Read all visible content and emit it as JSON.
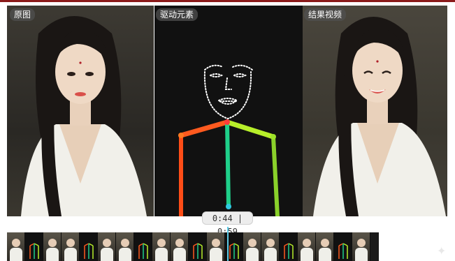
{
  "labels": {
    "original": "原图",
    "driver": "驱动元素",
    "result": "结果视频"
  },
  "player": {
    "time": "0:44 | 0:59"
  },
  "colors": {
    "accent_line": "#8b1a1a",
    "playhead": "#5ecbe6",
    "skeleton_left_arm": "#ff5a1f",
    "skeleton_spine": "#1fd08a",
    "skeleton_right_arm": "#b7ef2a"
  },
  "icons": {
    "corner": "sparkle-icon"
  }
}
